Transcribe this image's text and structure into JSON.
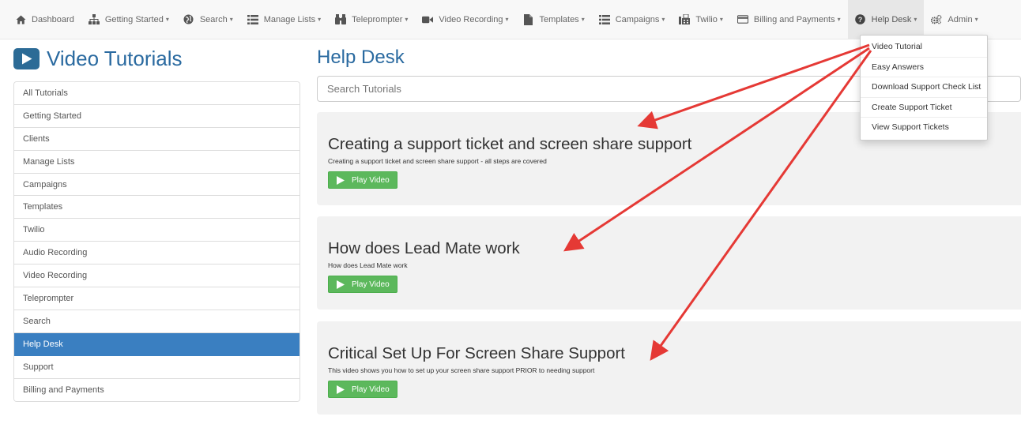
{
  "nav": {
    "items": [
      {
        "label": "Dashboard",
        "icon": "home-icon",
        "caret": false
      },
      {
        "label": "Getting Started",
        "icon": "sitemap-icon",
        "caret": true
      },
      {
        "label": "Search",
        "icon": "globe-icon",
        "caret": true
      },
      {
        "label": "Manage Lists",
        "icon": "list-icon",
        "caret": true
      },
      {
        "label": "Teleprompter",
        "icon": "binoculars-icon",
        "caret": true
      },
      {
        "label": "Video Recording",
        "icon": "video-camera-icon",
        "caret": true
      },
      {
        "label": "Templates",
        "icon": "file-icon",
        "caret": true
      },
      {
        "label": "Campaigns",
        "icon": "list-icon",
        "caret": true
      },
      {
        "label": "Twilio",
        "icon": "fax-icon",
        "caret": true
      },
      {
        "label": "Billing and Payments",
        "icon": "credit-card-icon",
        "caret": true
      },
      {
        "label": "Help Desk",
        "icon": "question-circle-icon",
        "caret": true
      },
      {
        "label": "Admin",
        "icon": "cogs-icon",
        "caret": true
      }
    ],
    "caret_glyph": "▾"
  },
  "dropdown": {
    "items": [
      "Video Tutorial",
      "Easy Answers",
      "Download Support Check List",
      "Create Support Ticket",
      "View Support Tickets"
    ]
  },
  "sidebar": {
    "title": "Video Tutorials",
    "items": [
      "All Tutorials",
      "Getting Started",
      "Clients",
      "Manage Lists",
      "Campaigns",
      "Templates",
      "Twilio",
      "Audio Recording",
      "Video Recording",
      "Teleprompter",
      "Search",
      "Help Desk",
      "Support",
      "Billing and Payments"
    ],
    "active_index": 11
  },
  "main": {
    "title": "Help Desk",
    "search_placeholder": "Search Tutorials",
    "play_label": "Play Video",
    "cards": [
      {
        "title": "Creating a support ticket and screen share support",
        "description": "Creating a support ticket and screen share support - all steps are covered"
      },
      {
        "title": "How does Lead Mate work",
        "description": "How does Lead Mate work"
      },
      {
        "title": "Critical Set Up For Screen Share Support",
        "description": "This video shows you how to set up your screen share support PRIOR to needing support"
      }
    ]
  },
  "colors": {
    "accent": "#2a6aa0",
    "active_item": "#3a7fc1",
    "play_button": "#5cb85c",
    "annotation_arrow": "#e53935"
  }
}
